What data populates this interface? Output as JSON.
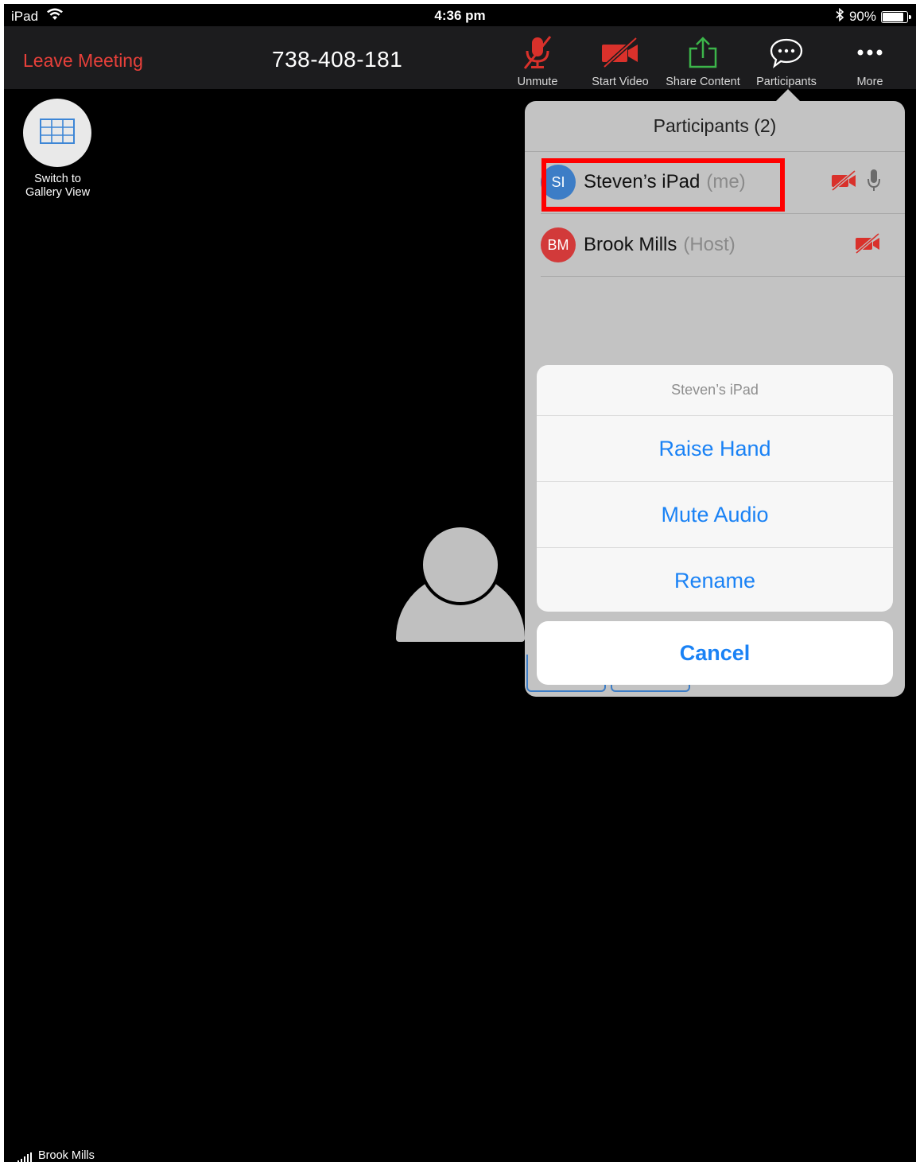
{
  "status_bar": {
    "device": "iPad",
    "time": "4:36 pm",
    "battery": "90%",
    "battery_level": 0.9,
    "wifi_icon": "wifi-icon",
    "bluetooth_icon": "bluetooth-icon"
  },
  "toolbar": {
    "leave_label": "Leave Meeting",
    "meeting_id": "738-408-181",
    "buttons": [
      {
        "label": "Unmute",
        "icon": "mic-muted-icon"
      },
      {
        "label": "Start Video",
        "icon": "video-off-icon"
      },
      {
        "label": "Share Content",
        "icon": "share-icon"
      },
      {
        "label": "Participants",
        "icon": "chat-bubble-icon"
      },
      {
        "label": "More",
        "icon": "more-icon"
      }
    ]
  },
  "gallery": {
    "label_line1": "Switch to",
    "label_line2": "Gallery View"
  },
  "participants": {
    "title": "Participants (2)",
    "list": [
      {
        "initials": "SI",
        "name": "Steven’s iPad",
        "tag": "(me)",
        "color": "#3d7dc6"
      },
      {
        "initials": "BM",
        "name": "Brook Mills",
        "tag": "(Host)",
        "color": "#d23a3a"
      }
    ]
  },
  "action_sheet": {
    "title": "Steven’s iPad",
    "items": [
      "Raise Hand",
      "Mute Audio",
      "Rename"
    ],
    "cancel": "Cancel"
  },
  "bottom": {
    "active_speaker": "Brook Mills"
  },
  "colors": {
    "leave_red": "#e8403a",
    "link_blue": "#1a82f5",
    "share_green": "#3cb54a",
    "muted_red": "#d9312b"
  }
}
